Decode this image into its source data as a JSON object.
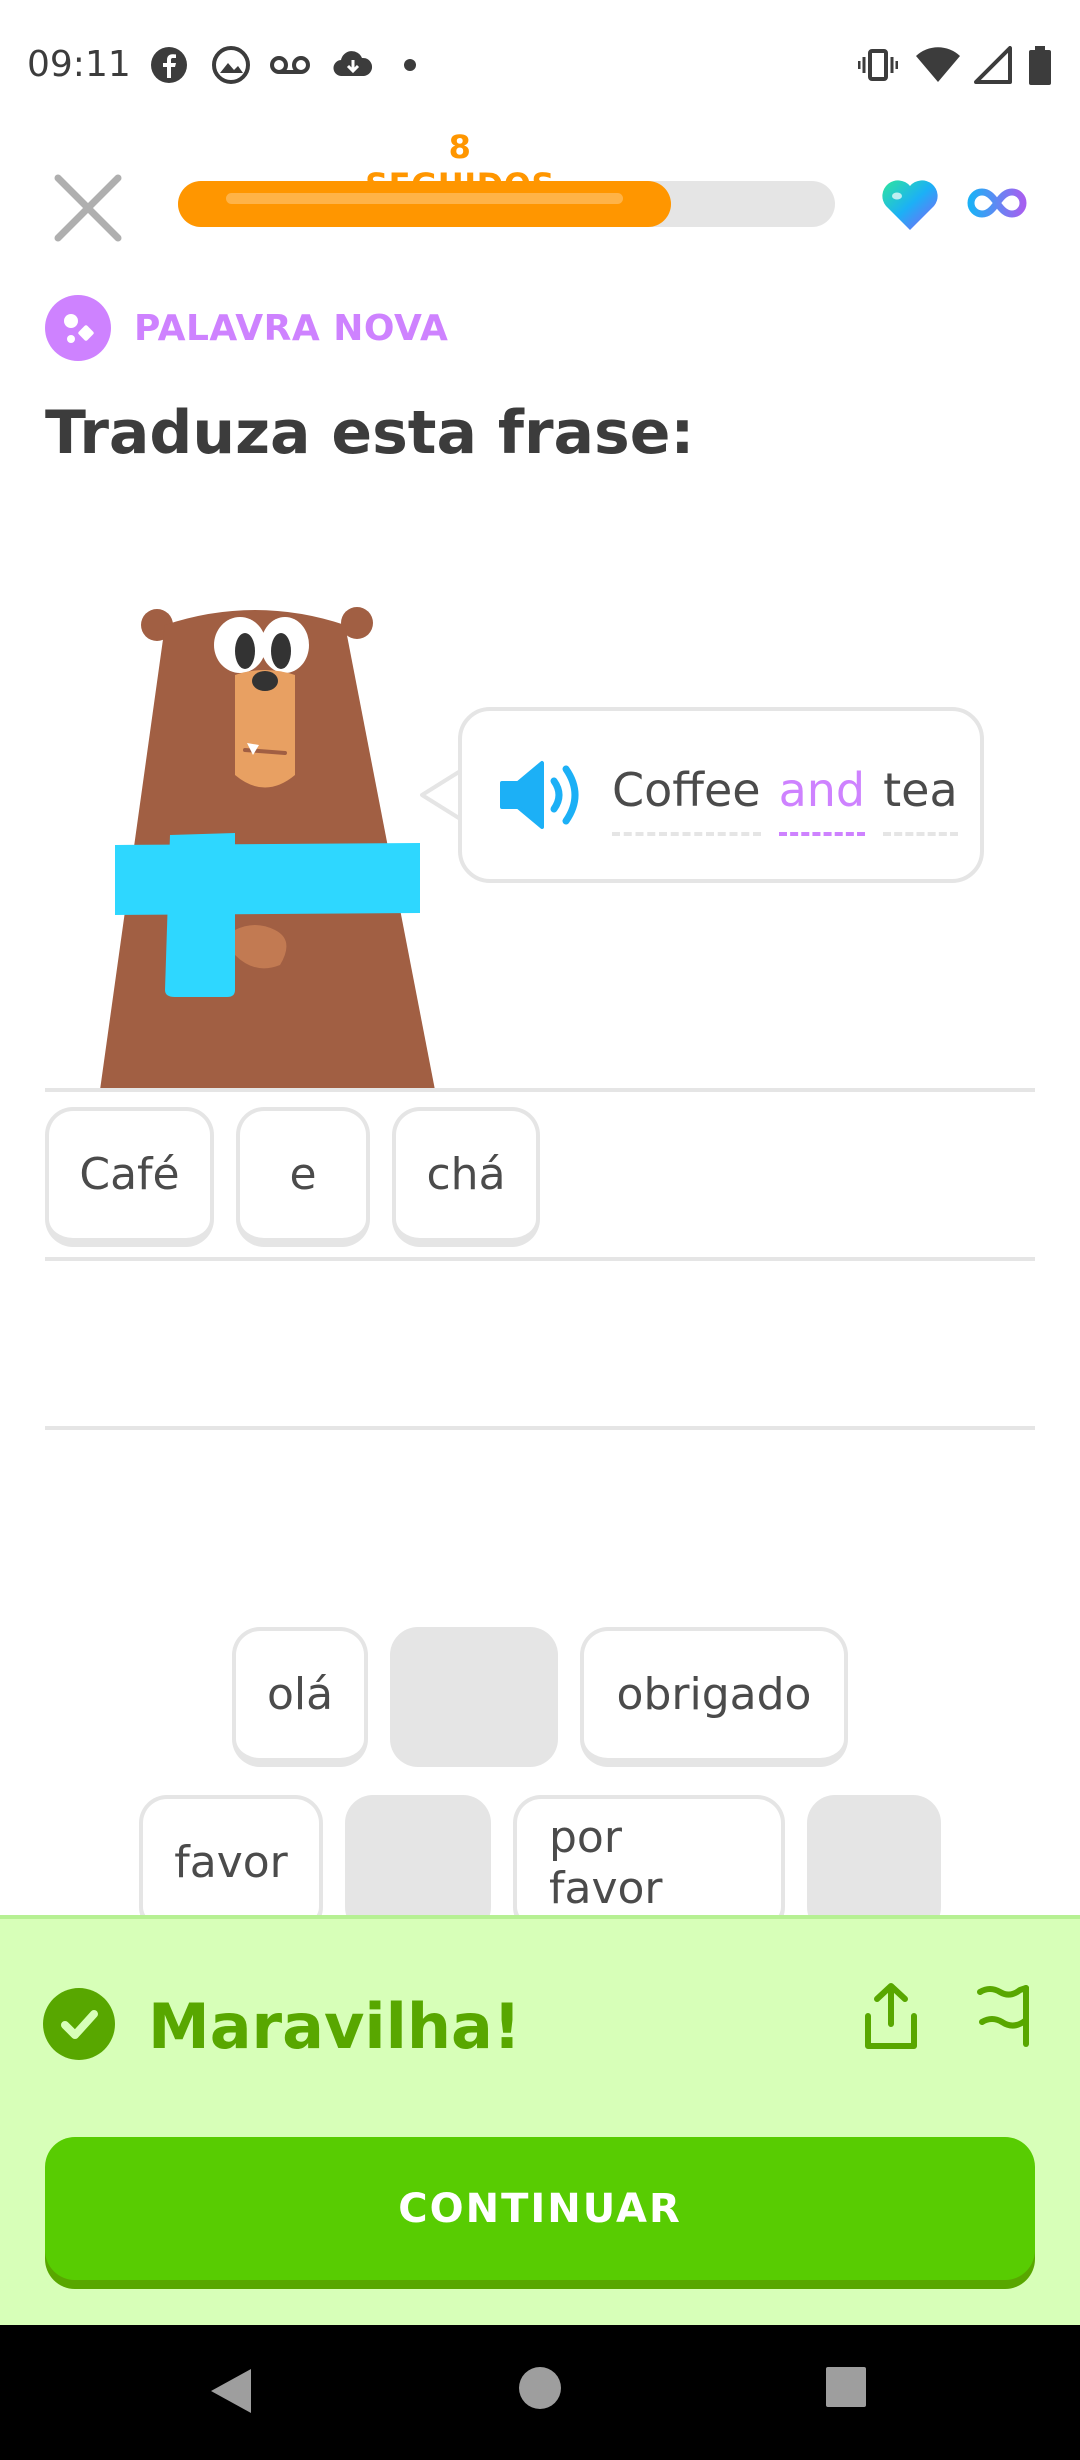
{
  "status_bar": {
    "time": "09:11",
    "left_icons": [
      "facebook-icon",
      "photo-icon",
      "voicemail-icon",
      "cloud-download-icon",
      "dot-icon"
    ],
    "right_icons": [
      "vibrate-icon",
      "wifi-icon",
      "signal-icon",
      "battery-icon"
    ]
  },
  "header": {
    "streak_label": "8 SEGUIDOS",
    "progress": 0.75,
    "lives": "infinite"
  },
  "badge": {
    "label": "PALAVRA NOVA"
  },
  "title": "Traduza esta frase:",
  "prompt": {
    "words": [
      {
        "text": "Coffee",
        "new": false
      },
      {
        "text": "and",
        "new": true
      },
      {
        "text": "tea",
        "new": false
      }
    ]
  },
  "answer": {
    "tiles": [
      "Café",
      "e",
      "chá"
    ]
  },
  "word_bank": {
    "row1": [
      {
        "text": "olá",
        "used": false
      },
      {
        "text": "",
        "used": true
      },
      {
        "text": "obrigado",
        "used": false
      }
    ],
    "row2": [
      {
        "text": "favor",
        "used": false
      },
      {
        "text": "",
        "used": true
      },
      {
        "text": "por favor",
        "used": false
      },
      {
        "text": "",
        "used": true
      }
    ]
  },
  "feedback": {
    "title": "Maravilha!",
    "continue_label": "CONTINUAR"
  },
  "colors": {
    "accent_orange": "#ff9600",
    "accent_purple": "#ce82ff",
    "success_green": "#58cc02",
    "success_dark": "#58a700",
    "feedback_bg": "#d7ffb8",
    "speaker_blue": "#1cb0f6"
  }
}
